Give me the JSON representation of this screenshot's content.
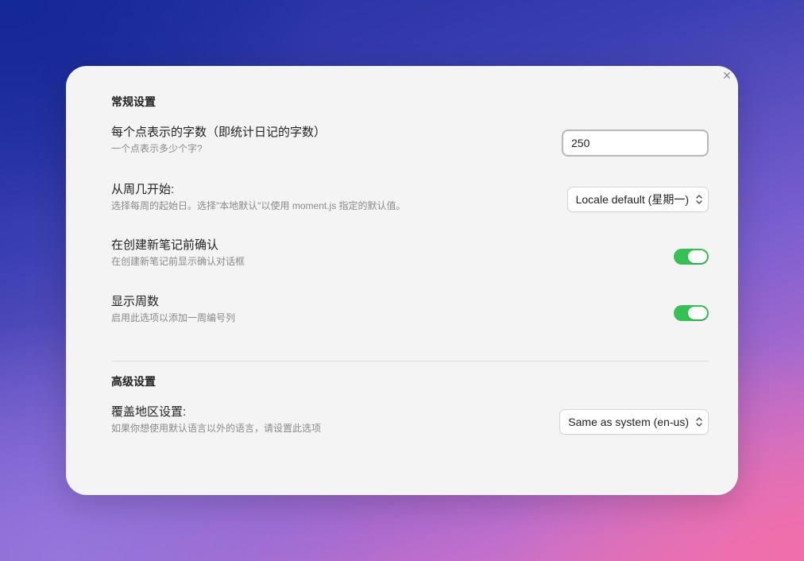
{
  "modal": {
    "close_label": "×"
  },
  "general": {
    "heading": "常规设置",
    "words_per_dot": {
      "name": "每个点表示的字数（即统计日记的字数）",
      "desc": "一个点表示多少个字?",
      "value": "250"
    },
    "week_start": {
      "name": "从周几开始:",
      "desc": "选择每周的起始日。选择\"本地默认\"以使用 moment.js 指定的默认值。",
      "selected": "Locale default (星期一)"
    },
    "confirm_create": {
      "name": "在创建新笔记前确认",
      "desc": "在创建新笔记前显示确认对话框",
      "enabled": true
    },
    "show_week_numbers": {
      "name": "显示周数",
      "desc": "启用此选项以添加一周编号列",
      "enabled": true
    }
  },
  "advanced": {
    "heading": "高级设置",
    "locale_override": {
      "name": "覆盖地区设置:",
      "desc": "如果你想使用默认语言以外的语言，请设置此选项",
      "selected": "Same as system (en-us)"
    }
  },
  "colors": {
    "toggle_on": "#37c155",
    "modal_bg": "#f4f4f4"
  }
}
